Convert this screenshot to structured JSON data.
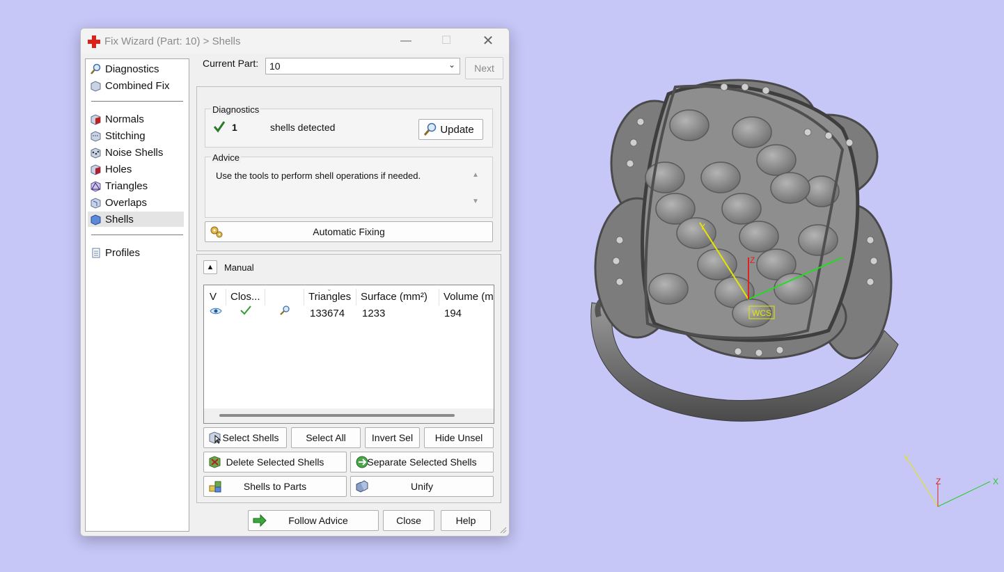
{
  "window": {
    "title": "Fix Wizard (Part: 10) > Shells",
    "controls": [
      "minimize",
      "maximize",
      "close"
    ]
  },
  "nav": {
    "items": [
      {
        "label": "Diagnostics",
        "icon": "magnifier-icon"
      },
      {
        "label": "Combined Fix",
        "icon": "cube-icon"
      },
      {
        "label": "Normals",
        "icon": "cube-red-icon"
      },
      {
        "label": "Stitching",
        "icon": "cube-stitch-icon"
      },
      {
        "label": "Noise Shells",
        "icon": "cube-dots-icon"
      },
      {
        "label": "Holes",
        "icon": "cube-hole-icon"
      },
      {
        "label": "Triangles",
        "icon": "cube-triangle-icon"
      },
      {
        "label": "Overlaps",
        "icon": "cube-overlap-icon"
      },
      {
        "label": "Shells",
        "icon": "cube-shell-icon",
        "selected": true
      },
      {
        "label": "Profiles",
        "icon": "document-icon"
      }
    ]
  },
  "top": {
    "current_part_label": "Current Part:",
    "current_part_value": "10",
    "next_label": "Next"
  },
  "diagnostics": {
    "title": "Diagnostics",
    "count": "1",
    "status_text": "shells detected",
    "update_label": "Update"
  },
  "advice": {
    "title": "Advice",
    "text": "Use the tools to perform shell operations if needed."
  },
  "automatic_fixing_label": "Automatic Fixing",
  "manual": {
    "title": "Manual",
    "columns": [
      "V",
      "Clos...",
      "",
      "Triangles",
      "Surface (mm²)",
      "Volume (m"
    ],
    "rows": [
      {
        "triangles": "133674",
        "surface": "1233",
        "volume": "194"
      }
    ]
  },
  "actions": {
    "select_shells": "Select Shells",
    "select_all": "Select All",
    "invert_sel": "Invert Sel",
    "hide_unsel": "Hide Unsel",
    "delete_selected": "Delete Selected Shells",
    "separate_selected": "Separate Selected Shells",
    "shells_to_parts": "Shells to Parts",
    "unify": "Unify"
  },
  "footer": {
    "follow_advice": "Follow Advice",
    "close": "Close",
    "help": "Help"
  },
  "viewport": {
    "wcs_label": "WCS",
    "axis_x": "X",
    "axis_y": "Y",
    "axis_z": "Z"
  },
  "colors": {
    "background": "#c6c6f7",
    "check_green": "#2e9e2e",
    "title_cross": "#d8221a"
  }
}
